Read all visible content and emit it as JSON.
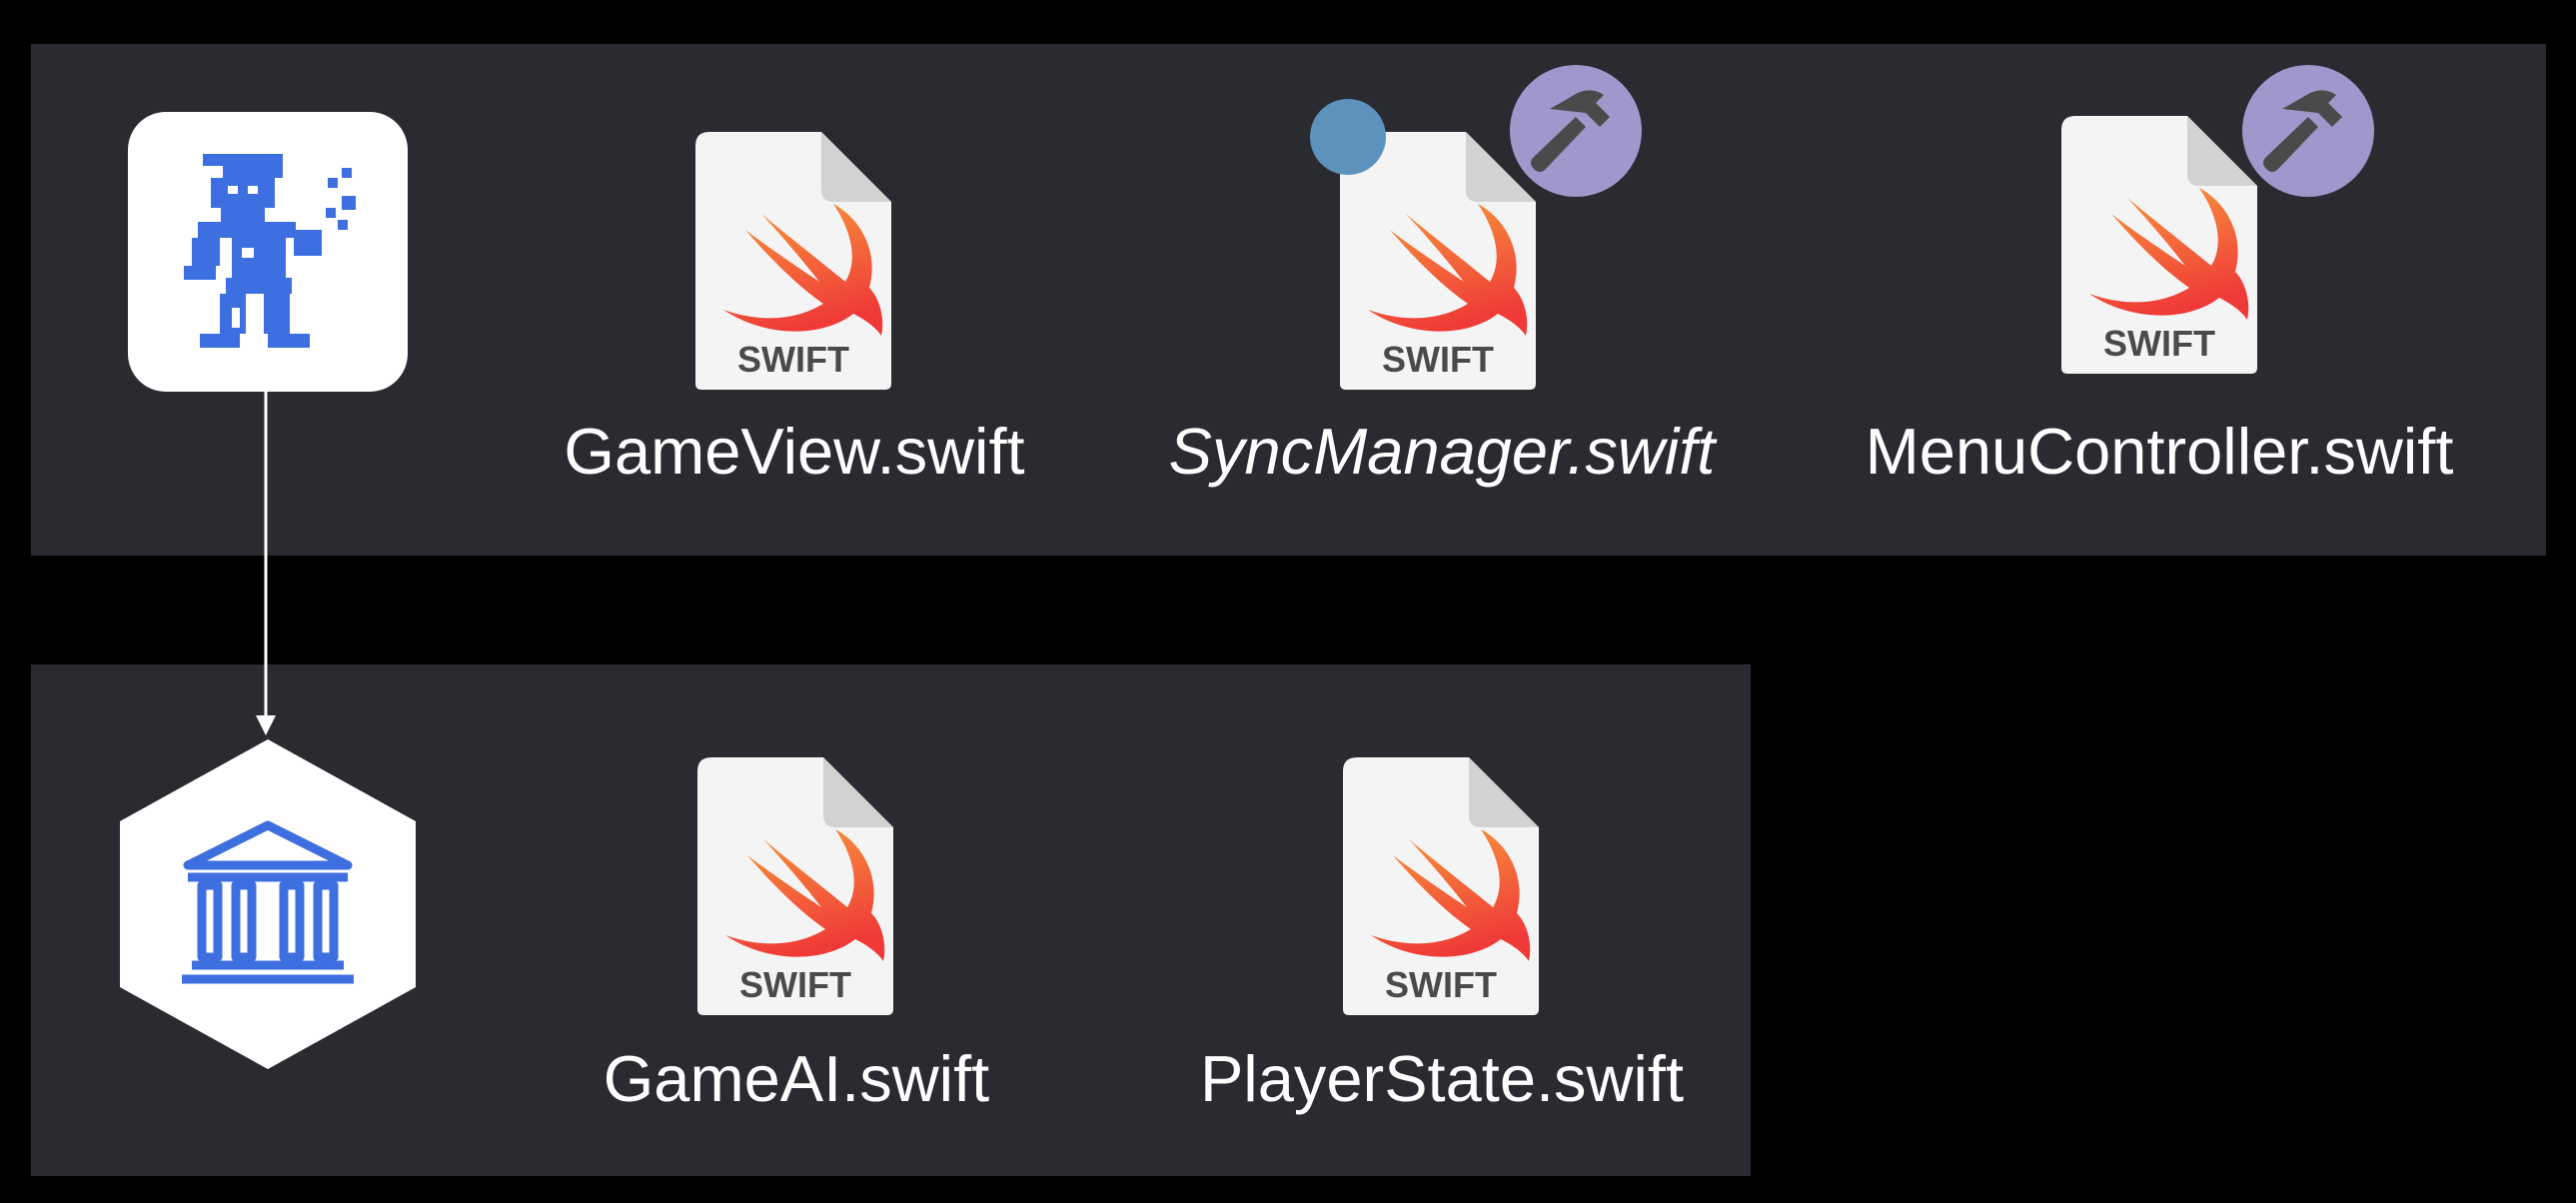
{
  "colors": {
    "background": "#000000",
    "panel": "#2a2b30",
    "label_text": "#ffffff",
    "app_icon_blue": "#3d6fe0",
    "hammer_badge": "#a097cc",
    "status_dot": "#5d92bd",
    "swift_orange": "#f05138"
  },
  "app_target": {
    "icon": "pixel-character-app-icon",
    "files": [
      {
        "name": "GameView.swift",
        "file_type_label": "SWIFT",
        "icon": "swift-file-icon"
      },
      {
        "name": "SyncManager.swift",
        "file_type_label": "SWIFT",
        "icon": "swift-file-icon",
        "italic": true,
        "badges": [
          "status-dot",
          "hammer-icon"
        ]
      },
      {
        "name": "MenuController.swift",
        "file_type_label": "SWIFT",
        "icon": "swift-file-icon",
        "badges": [
          "hammer-icon"
        ]
      }
    ]
  },
  "library_target": {
    "icon": "library-building-icon",
    "files": [
      {
        "name": "GameAI.swift",
        "file_type_label": "SWIFT",
        "icon": "swift-file-icon"
      },
      {
        "name": "PlayerState.swift",
        "file_type_label": "SWIFT",
        "icon": "swift-file-icon"
      }
    ]
  }
}
